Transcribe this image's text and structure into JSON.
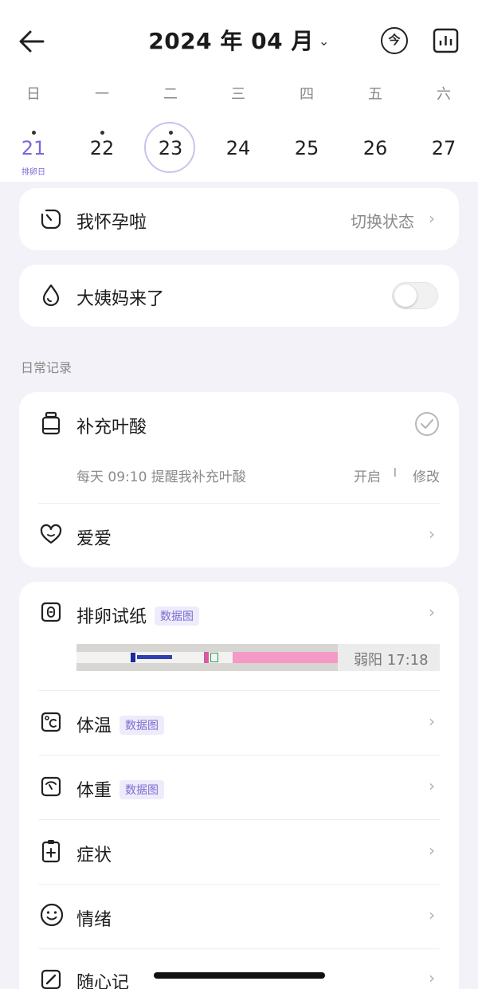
{
  "header": {
    "title": "2024 年 04 月",
    "today_button": "今"
  },
  "weekdays": [
    "日",
    "一",
    "二",
    "三",
    "四",
    "五",
    "六"
  ],
  "days": [
    {
      "num": "21",
      "sub": "排卵日"
    },
    {
      "num": "22",
      "sub": ""
    },
    {
      "num": "23",
      "sub": ""
    },
    {
      "num": "24",
      "sub": ""
    },
    {
      "num": "25",
      "sub": ""
    },
    {
      "num": "26",
      "sub": ""
    },
    {
      "num": "27",
      "sub": ""
    }
  ],
  "pregnant_card": {
    "label": "我怀孕啦",
    "action": "切换状态"
  },
  "period_card": {
    "label": "大姨妈来了",
    "toggle_on": false
  },
  "daily": {
    "section_label": "日常记录",
    "folic": {
      "label": "补充叶酸",
      "reminder": "每天 09:10 提醒我补充叶酸",
      "enable": "开启",
      "sep": "I",
      "edit": "修改"
    },
    "love": {
      "label": "爱爱"
    }
  },
  "records": {
    "ovulation": {
      "label": "排卵试纸",
      "tag": "数据图",
      "result": "弱阳 17:18"
    },
    "temperature": {
      "label": "体温",
      "tag": "数据图"
    },
    "weight": {
      "label": "体重",
      "tag": "数据图"
    },
    "symptoms": {
      "label": "症状"
    },
    "mood": {
      "label": "情绪"
    },
    "notes": {
      "label": "随心记"
    }
  },
  "colors": {
    "accent": "#7a68d8",
    "background": "#f3f2f8",
    "card": "#ffffff"
  }
}
